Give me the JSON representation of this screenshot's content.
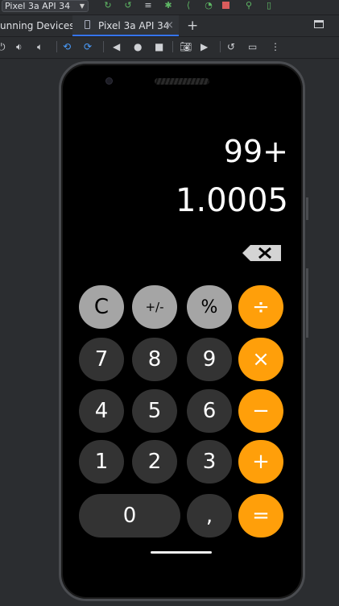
{
  "toolbar": {
    "device_select": "Pixel 3a API 34",
    "icons": [
      "sync-icon",
      "apply-changes-icon",
      "layout-icon",
      "bug-icon",
      "attach-icon",
      "profile-icon",
      "stop-icon",
      "inspect-icon",
      "device-manager-icon"
    ]
  },
  "tabs": {
    "running_devices_label": "unning Devices:",
    "device_tab": "Pixel 3a API 34",
    "close": "×",
    "add": "+"
  },
  "emulator_toolbar": {
    "icons": [
      "power-icon",
      "volume-up-icon",
      "volume-down-icon",
      "rotate-left-icon",
      "rotate-right-icon",
      "back-icon",
      "home-icon",
      "overview-icon",
      "screenshot-icon",
      "record-icon",
      "snapshot-icon",
      "extended-controls-icon",
      "more-icon"
    ]
  },
  "calculator": {
    "expression": "99+",
    "result": "1.0005",
    "keys": {
      "clear": "C",
      "sign": "+/-",
      "percent": "%",
      "divide": "÷",
      "seven": "7",
      "eight": "8",
      "nine": "9",
      "multiply": "×",
      "four": "4",
      "five": "5",
      "six": "6",
      "minus": "−",
      "one": "1",
      "two": "2",
      "three": "3",
      "plus": "+",
      "zero": "0",
      "decimal": ",",
      "equals": "="
    }
  },
  "colors": {
    "light_key": "#a5a5a5",
    "dark_key": "#333333",
    "operator_key": "#ff9f0a",
    "ide_background": "#2b2d30",
    "tab_accent": "#3574f0"
  }
}
